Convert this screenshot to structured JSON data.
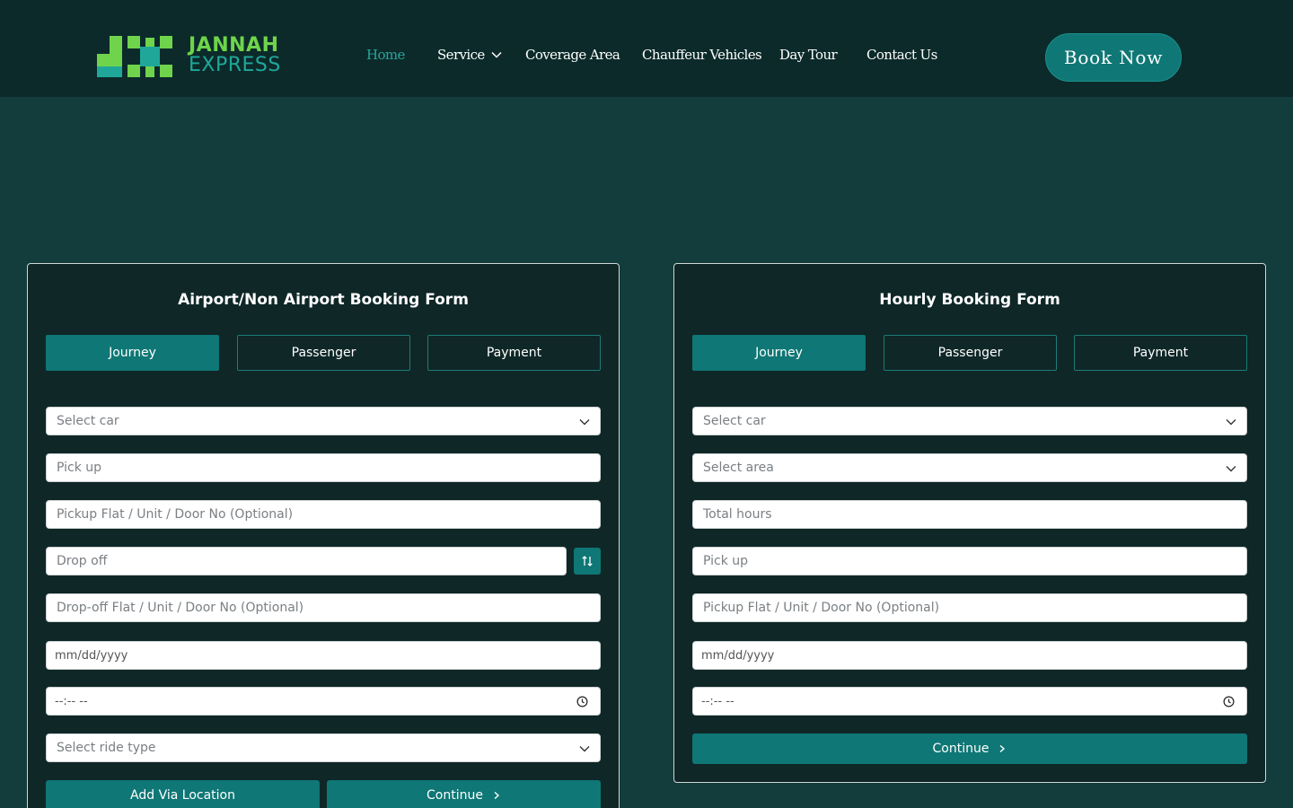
{
  "brand": {
    "name_line1": "JANNAH",
    "name_line2": "EXPRESS",
    "mark_green": "#6fd44b",
    "mark_teal": "#1fa89a"
  },
  "nav": {
    "items": [
      {
        "label": "Home",
        "active": true
      },
      {
        "label": "Service",
        "has_dropdown": true,
        "icon": "chevron-down-icon"
      },
      {
        "label": "Coverage Area"
      },
      {
        "label": "Chauffeur Vehicles"
      },
      {
        "label": "Day Tour"
      },
      {
        "label": "Contact Us"
      }
    ],
    "cta_label": "Book Now"
  },
  "colors": {
    "header_bg": "#0c2a2a",
    "page_bg": "#133c3c",
    "accent": "#0f7775",
    "active_link": "#2aa59b"
  },
  "airport_form": {
    "title": "Airport/Non Airport Booking Form",
    "tabs": [
      {
        "label": "Journey",
        "active": true
      },
      {
        "label": "Passenger"
      },
      {
        "label": "Payment"
      }
    ],
    "fields": {
      "car": {
        "placeholder": "Select car",
        "type": "select"
      },
      "pickup": {
        "placeholder": "Pick up"
      },
      "pickup_flat": {
        "placeholder": "Pickup Flat / Unit / Door No (Optional)"
      },
      "dropoff": {
        "placeholder": "Drop off"
      },
      "dropoff_flat": {
        "placeholder": "Drop-off Flat / Unit / Door No (Optional)"
      },
      "date": {
        "placeholder": "mm/dd/yyyy"
      },
      "time": {
        "placeholder": "--:-- --"
      },
      "ride_type": {
        "placeholder": "Select ride type",
        "type": "select"
      }
    },
    "swap_icon": "swap-vertical-icon",
    "add_via_label": "Add Via Location",
    "continue_label": "Continue"
  },
  "hourly_form": {
    "title": "Hourly Booking Form",
    "tabs": [
      {
        "label": "Journey",
        "active": true
      },
      {
        "label": "Passenger"
      },
      {
        "label": "Payment"
      }
    ],
    "fields": {
      "car": {
        "placeholder": "Select car",
        "type": "select"
      },
      "area": {
        "placeholder": "Select area",
        "type": "select"
      },
      "hours": {
        "placeholder": "Total hours"
      },
      "pickup": {
        "placeholder": "Pick up"
      },
      "pickup_flat": {
        "placeholder": "Pickup Flat / Unit / Door No (Optional)"
      },
      "date": {
        "placeholder": "mm/dd/yyyy"
      },
      "time": {
        "placeholder": "--:-- --"
      }
    },
    "continue_label": "Continue"
  }
}
